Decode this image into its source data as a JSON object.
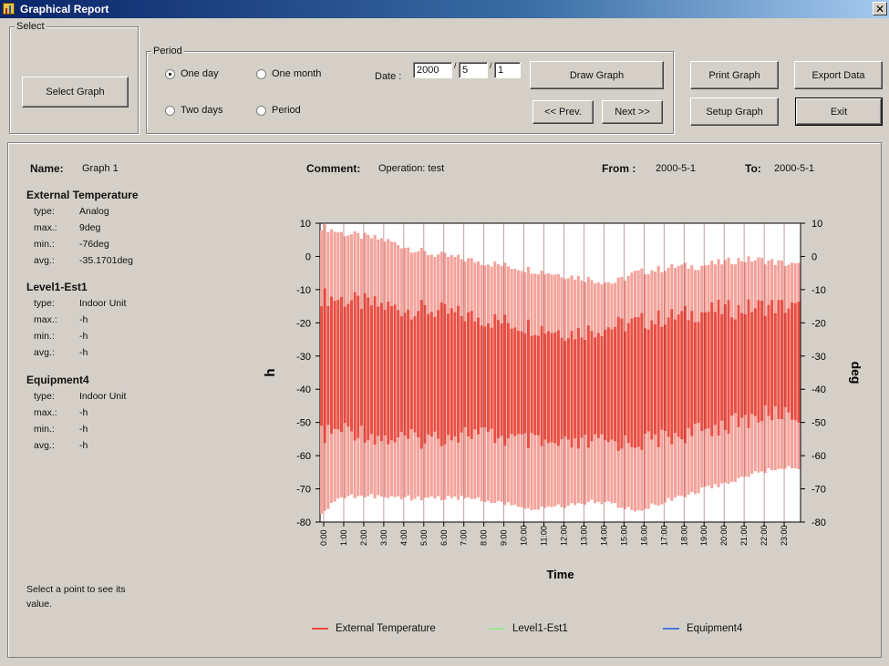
{
  "window": {
    "title": "Graphical Report"
  },
  "select_group": {
    "label": "Select",
    "button": "Select Graph"
  },
  "period_group": {
    "label": "Period",
    "options": [
      {
        "label": "One day",
        "checked": true
      },
      {
        "label": "One month",
        "checked": false
      },
      {
        "label": "Two days",
        "checked": false
      },
      {
        "label": "Period",
        "checked": false
      }
    ],
    "date_label": "Date :",
    "year": "2000",
    "month": "5",
    "day": "1",
    "draw_button": "Draw Graph",
    "prev_button": "<< Prev.",
    "next_button": "Next >>"
  },
  "actions": {
    "print": "Print Graph",
    "export": "Export Data",
    "setup": "Setup Graph",
    "exit": "Exit"
  },
  "report": {
    "name_label": "Name:",
    "name": "Graph 1",
    "comment_label": "Comment:",
    "comment": "Operation: test",
    "from_label": "From :",
    "from": "2000-5-1",
    "to_label": "To:",
    "to": "2000-5-1",
    "type_key": "type:",
    "max_key": "max.:",
    "min_key": "min.:",
    "avg_key": "avg.:",
    "points": [
      {
        "title": "External Temperature",
        "type": "Analog",
        "max": "9deg",
        "min": "-76deg",
        "avg": "-35.1701deg"
      },
      {
        "title": "Level1-Est1",
        "type": "Indoor Unit",
        "max": "-h",
        "min": "-h",
        "avg": "-h"
      },
      {
        "title": "Equipment4",
        "type": "Indoor Unit",
        "max": "-h",
        "min": "-h",
        "avg": "-h"
      }
    ],
    "hint": "Select a point to see its value."
  },
  "chart_data": {
    "type": "area",
    "xlabel": "Time",
    "ylabel_left": "h",
    "ylabel_right": "deg",
    "ylim": [
      -80,
      10
    ],
    "yticks": [
      10,
      0,
      -10,
      -20,
      -30,
      -40,
      -50,
      -60,
      -70,
      -80
    ],
    "x_ticks": [
      "0:00",
      "1:00",
      "2:00",
      "3:00",
      "4:00",
      "5:00",
      "6:00",
      "7:00",
      "8:00",
      "9:00",
      "10:00",
      "11:00",
      "12:00",
      "13:00",
      "14:00",
      "15:00",
      "16:00",
      "17:00",
      "18:00",
      "19:00",
      "20:00",
      "21:00",
      "22:00",
      "23:00"
    ],
    "grid": true,
    "series": [
      {
        "name": "External Temperature",
        "color": "#e8463a",
        "upper": [
          9,
          7,
          6,
          5,
          3,
          1,
          0,
          -1,
          -2,
          -3,
          -4,
          -5,
          -6,
          -7,
          -8,
          -5,
          -4,
          -3,
          -3,
          -2,
          -1,
          -1,
          -2,
          -3
        ],
        "upper_core": [
          -12,
          -13,
          -14,
          -15,
          -16,
          -16,
          -17,
          -18,
          -19,
          -20,
          -21,
          -22,
          -23,
          -22,
          -21,
          -20,
          -19,
          -18,
          -17,
          -16,
          -16,
          -15,
          -15,
          -16
        ],
        "lower_core": [
          -54,
          -52,
          -53,
          -55,
          -55,
          -55,
          -54,
          -53,
          -54,
          -55,
          -56,
          -57,
          -57,
          -56,
          -56,
          -56,
          -55,
          -54,
          -53,
          -51,
          -50,
          -48,
          -47,
          -48
        ],
        "lower": [
          -76,
          -72,
          -71,
          -72,
          -72,
          -72,
          -72,
          -72,
          -73,
          -74,
          -75,
          -75,
          -74,
          -73,
          -74,
          -76,
          -74,
          -72,
          -70,
          -68,
          -66,
          -64,
          -63,
          -63
        ]
      },
      {
        "name": "Level1-Est1",
        "color": "#9fe39a"
      },
      {
        "name": "Equipment4",
        "color": "#4a78d8"
      }
    ]
  }
}
